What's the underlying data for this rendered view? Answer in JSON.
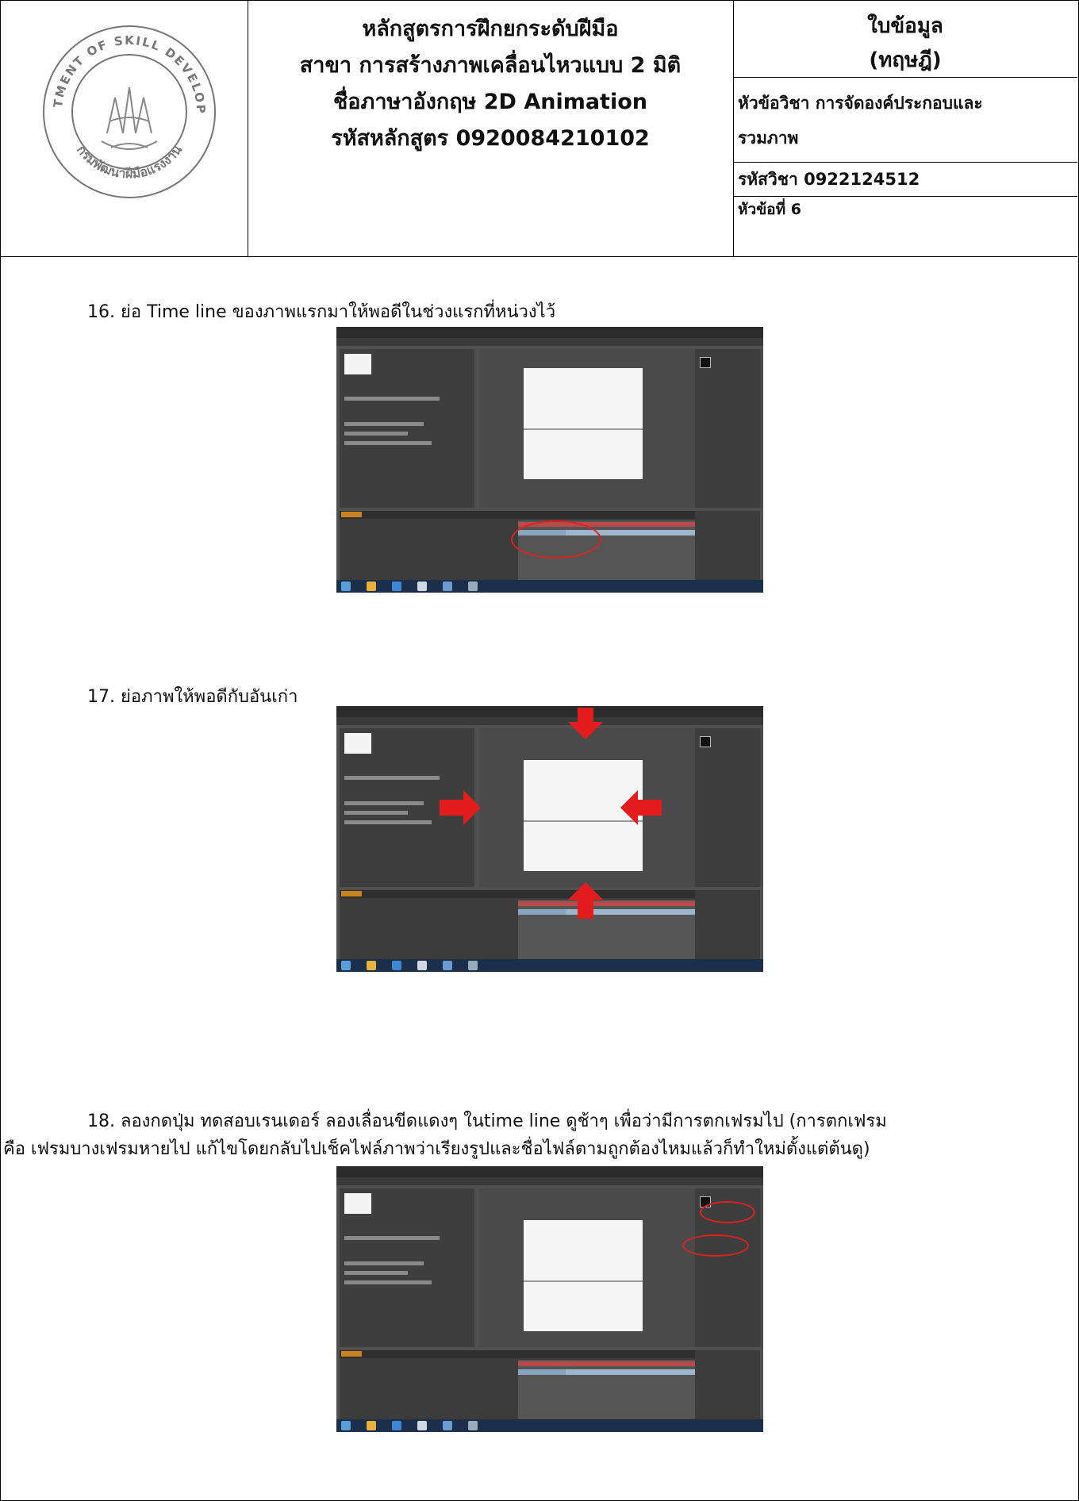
{
  "header": {
    "seal_text": "DEPARTMENT OF SKILL DEVELOPMENT",
    "seal_text_th": "กรมพัฒนาฝีมือแรงงาน",
    "course_lines": [
      "หลักสูตรการฝึกยกระดับฝีมือ",
      "สาขา การสร้างภาพเคลื่อนไหวแบบ 2 มิติ",
      "ชื่อภาษาอังกฤษ 2D Animation",
      "รหัสหลักสูตร 0920084210102"
    ],
    "sheet_title_1": "ใบข้อมูล",
    "sheet_title_2": "(ทฤษฎี)",
    "subject_line_1": "หัวข้อวิชา การจัดองค์ประกอบและ",
    "subject_line_2": "รวมภาพ",
    "subject_code": "รหัสวิชา 0922124512",
    "topic_no": "หัวข้อที่ 6"
  },
  "steps": [
    {
      "text": "16. ย่อ Time line ของภาพแรกมาให้พอดีในช่วงแรกที่หน่วงไว้"
    },
    {
      "text": "17. ย่อภาพให้พอดีกับอันเก่า"
    },
    {
      "text_line_1": "18. ลองกดปุ่ม ทดสอบเรนเดอร์ ลองเลื่อนขีดแดงๆ ในtime line ดูช้าๆ เพื่อว่ามีการตกเฟรมไป (การตกเฟรม",
      "text_line_2": "คือ เฟรมบางเฟรมหายไป  แก้ไขโดยกลับไปเช็คไฟล์ภาพว่าเรียงรูปและชื่อไฟล์ตามถูกต้องไหมแล้วก็ทำใหม่ตั้งแต่ต้นดู)"
    }
  ],
  "colors": {
    "ae_panel": "#505050",
    "highlight": "#e31d1d",
    "taskbar": "#1b2f4a"
  }
}
